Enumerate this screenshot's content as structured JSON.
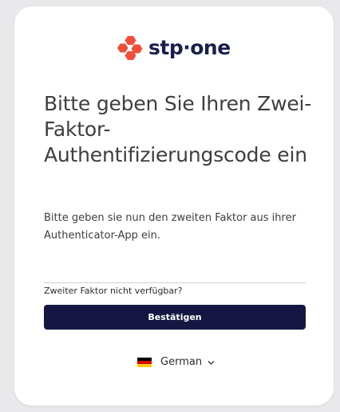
{
  "brand": {
    "name": "stp·one",
    "logo_color": "#f04e3a",
    "text_color": "#1a1f4d"
  },
  "title": "Bitte geben Sie Ihren Zwei-Faktor-Authentifizierungscode ein",
  "description": "Bitte geben sie nun den zweiten Faktor aus ihrer Authenticator-App ein.",
  "code_input": {
    "value": "",
    "placeholder": ""
  },
  "alt_link": "Zweiter Faktor nicht verfügbar?",
  "confirm_button": "Bestätigen",
  "language": {
    "selected": "German",
    "flag_icon": "flag-germany-icon",
    "chevron_icon": "chevron-down-icon"
  },
  "colors": {
    "primary_button": "#151742",
    "accent": "#f04e3a"
  }
}
